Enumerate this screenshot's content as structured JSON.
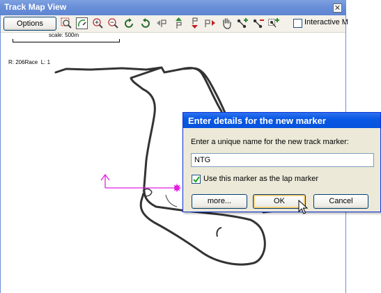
{
  "window": {
    "title": "Track Map View",
    "close_glyph": "✕"
  },
  "toolbar": {
    "options_label": "Options",
    "tools": [
      {
        "name": "zoom-region-icon"
      },
      {
        "name": "draw-track-icon"
      },
      {
        "name": "zoom-in-icon"
      },
      {
        "name": "zoom-out-icon"
      },
      {
        "name": "rotate-clockwise-icon"
      },
      {
        "name": "rotate-counterclockwise-icon"
      },
      {
        "name": "marker-left-icon"
      },
      {
        "name": "marker-up-icon"
      },
      {
        "name": "marker-down-icon"
      },
      {
        "name": "marker-right-icon"
      },
      {
        "name": "pan-hand-icon"
      },
      {
        "name": "add-node-icon"
      },
      {
        "name": "remove-node-icon"
      },
      {
        "name": "add-node-region-icon"
      }
    ],
    "interactive_label": "Interactive M"
  },
  "map": {
    "scale_label": "scale: 500m",
    "lap_info": "R: 206Race  L: 1",
    "track_color": "#333333",
    "marker_color": "#e020e0"
  },
  "dialog": {
    "title": "Enter details for the new marker",
    "prompt": "Enter a unique name for the new track marker:",
    "name_value": "NTG",
    "lap_marker_label": "Use this marker as the lap marker",
    "lap_marker_checked": true,
    "more_label": "more...",
    "ok_label": "OK",
    "cancel_label": "Cancel"
  },
  "colors": {
    "title_bar": "#6a8fd8",
    "dialog_title_bar": "#0a58e4",
    "dialog_background": "#ece9d8",
    "check_green": "#21a121"
  }
}
